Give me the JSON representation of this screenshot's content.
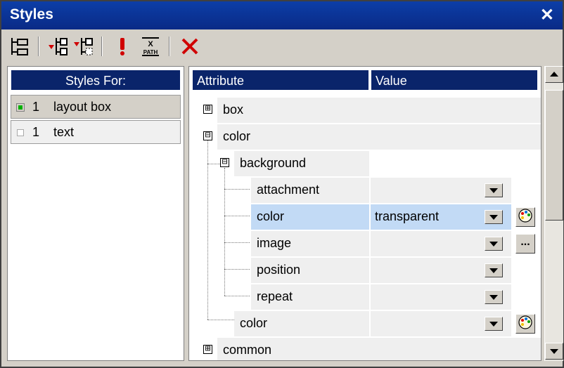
{
  "window": {
    "title": "Styles",
    "close_glyph": "✕"
  },
  "toolbar": {
    "buttons": [
      {
        "name": "tree-view-icon"
      },
      {
        "name": "add-style-icon"
      },
      {
        "name": "add-nested-style-icon"
      },
      {
        "name": "important-icon",
        "glyph": "!"
      },
      {
        "name": "xpath-icon",
        "label_top": "X",
        "label_bottom": "PATH"
      },
      {
        "name": "delete-icon",
        "glyph": "✕"
      }
    ]
  },
  "left_panel": {
    "header": "Styles For:",
    "rows": [
      {
        "num": "1",
        "label": "layout box",
        "selected": true
      },
      {
        "num": "1",
        "label": "text",
        "selected": false
      }
    ]
  },
  "right_panel": {
    "headers": {
      "attribute": "Attribute",
      "value": "Value"
    },
    "rows": [
      {
        "attr": "box",
        "toggle": "⊞",
        "value": ""
      },
      {
        "attr": "color",
        "toggle": "⊟",
        "value": ""
      },
      {
        "attr": "background",
        "toggle": "⊟",
        "value": ""
      },
      {
        "attr": "attachment",
        "value": ""
      },
      {
        "attr": "color",
        "value": "transparent",
        "selected": true
      },
      {
        "attr": "image",
        "value": "",
        "extra_button": "..."
      },
      {
        "attr": "position",
        "value": ""
      },
      {
        "attr": "repeat",
        "value": ""
      },
      {
        "attr": "color",
        "value": ""
      },
      {
        "attr": "common",
        "toggle": "⊞",
        "value": ""
      }
    ]
  },
  "colors": {
    "accent": "#0a246a",
    "selection": "#c2daf5",
    "panel": "#d4d0c8"
  }
}
